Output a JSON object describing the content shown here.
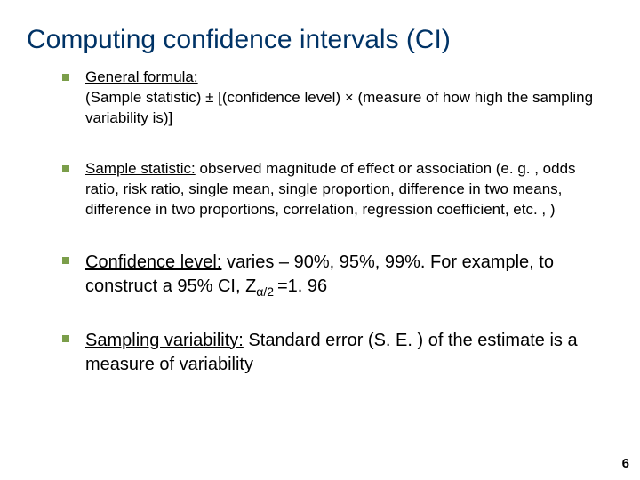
{
  "title": "Computing confidence intervals (CI)",
  "bullets": {
    "b0_label": "General formula:",
    "b0_body": "  (Sample statistic) ± [(confidence level) × (measure of how high the sampling variability is)]",
    "b1_label": "Sample statistic:",
    "b1_body": " observed magnitude of effect or association (e. g. , odds ratio, risk ratio, single mean, single proportion, difference in two means, difference in two proportions, correlation, regression coefficient, etc. , )",
    "b2_label": "Confidence level:",
    "b2_body_a": " varies – 90%, 95%, 99%.  For example, to construct a  95% CI, Z",
    "b2_sub": "α/2 ",
    "b2_body_b": "=1. 96",
    "b3_label": "Sampling variability:",
    "b3_body": " Standard error (S. E. ) of the estimate is a measure of variability"
  },
  "page_number": "6"
}
